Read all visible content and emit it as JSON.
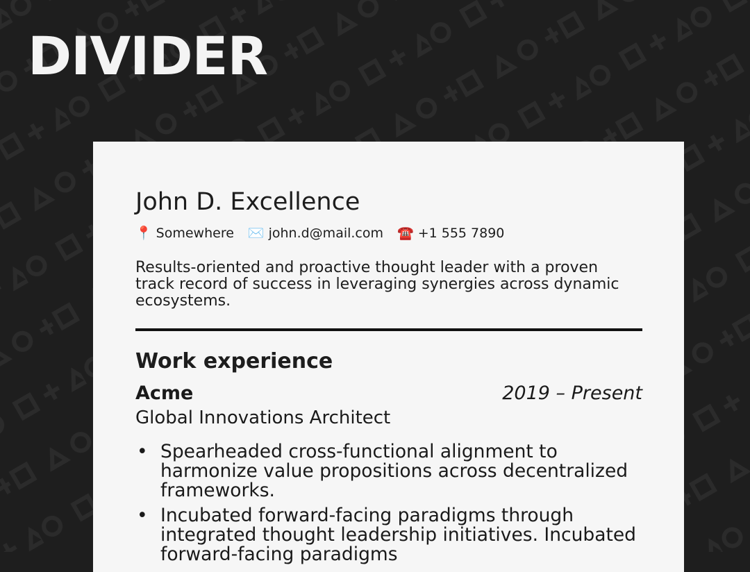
{
  "header": {
    "title": "DIVIDER"
  },
  "resume": {
    "name": "John D. Excellence",
    "contacts": [
      {
        "icon": "location-pin-icon",
        "glyph": "📍",
        "text": "Somewhere"
      },
      {
        "icon": "envelope-icon",
        "glyph": "✉️",
        "text": "john.d@mail.com"
      },
      {
        "icon": "telephone-icon",
        "glyph": "☎️",
        "text": "+1 555 7890"
      }
    ],
    "summary": "Results-oriented and proactive thought leader with a proven track record of success in leveraging synergies across dynamic ecosystems.",
    "section_title": "Work experience",
    "job": {
      "company": "Acme",
      "dates": "2019 – Present",
      "role": "Global Innovations Architect",
      "bullet_glyph": "•",
      "bullets": [
        "Spearheaded cross-functional alignment to harmonize value propositions across decentralized frameworks.",
        "Incubated forward-facing paradigms through integrated thought leadership initiatives. Incubated forward-facing paradigms"
      ]
    }
  }
}
